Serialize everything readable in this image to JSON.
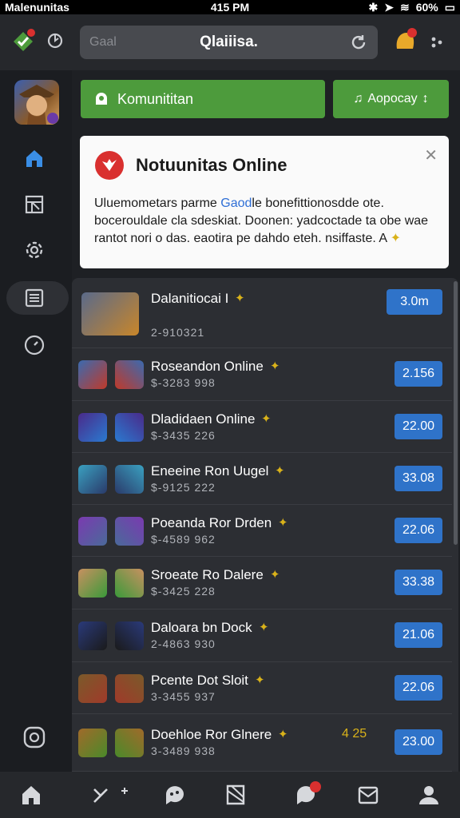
{
  "status_bar": {
    "carrier": "Malenunitas",
    "time": "415 PM",
    "battery": "60%"
  },
  "header": {
    "search_placeholder": "Gaal",
    "title": "Qlaiiisa."
  },
  "actions": {
    "primary_label": "Komunititan",
    "secondary_label": "Aopocay"
  },
  "notification": {
    "title": "Notuunitas Online",
    "body_pre": "Uluemometars parme ",
    "body_link": "Gaod",
    "body_post": "le bonefittionosdde ote. bocerouldale cla sdeskiat. Doonen: yadcoctade ta obe wae rantot nori o das. eaotira pe dahdo eteh. nsiffaste. A"
  },
  "games": [
    {
      "name": "Dalanitiocai I",
      "sub": "2-910321",
      "price": "3.0m",
      "icon1": "weapon-icon",
      "icon2": "sword-icon"
    },
    {
      "name": "Roseandon Online",
      "sub": "$-3283 998",
      "price": "2.156",
      "icon1": "rocket-icon",
      "icon2": "gem-icon"
    },
    {
      "name": "Dladidaen Online",
      "sub": "$-3435 226",
      "price": "22.00",
      "icon1": "star-icon",
      "icon2": "staff-icon"
    },
    {
      "name": "Eneeine Ron Uugel",
      "sub": "$-9125 222",
      "price": "33.08",
      "icon1": "hero-icon",
      "icon2": "armor-icon"
    },
    {
      "name": "Poeanda Ror Drden",
      "sub": "$-4589 962",
      "price": "22.06",
      "icon1": "mage-icon",
      "icon2": "knight-icon"
    },
    {
      "name": "Sroeate Ro Dalere",
      "sub": "$-3425 228",
      "price": "33.38",
      "icon1": "cowboy-icon",
      "icon2": "slime-icon"
    },
    {
      "name": "Daloara bn Dock",
      "sub": "2-4863 930",
      "price": "21.06",
      "icon1": "rogue-icon",
      "icon2": "dagger-icon"
    },
    {
      "name": "Pcente Dot Sloit",
      "sub": "3-3455 937",
      "price": "22.06",
      "icon1": "warrior-icon",
      "icon2": "castle-icon"
    },
    {
      "name": "Doehloe Ror Glnere",
      "sub": "3-3489 938",
      "price": "23.00",
      "icon1": "lion-icon",
      "icon2": "blade-icon",
      "badge": "4 25"
    }
  ],
  "colors": {
    "accent_green": "#4d9b3c",
    "price_blue": "#2f73c9",
    "notif_red": "#d9302f"
  }
}
